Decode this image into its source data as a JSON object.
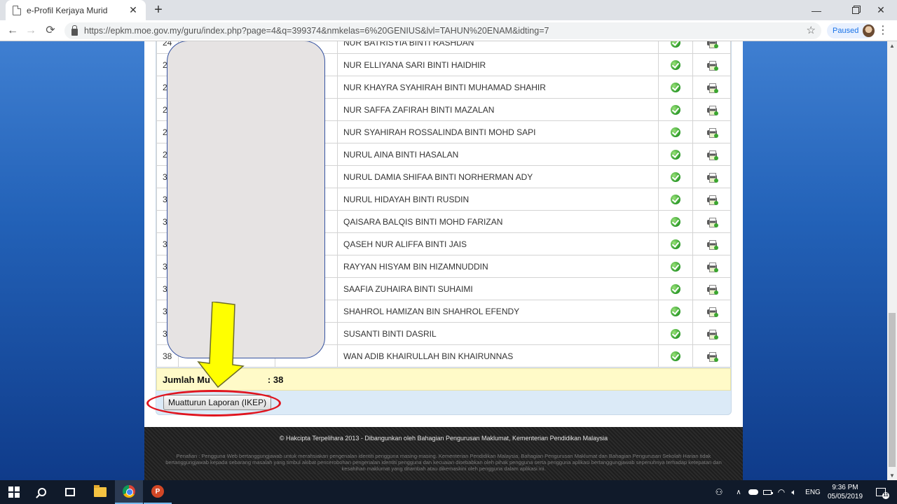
{
  "browser": {
    "tab_title": "e-Profil Kerjaya Murid",
    "tab_close": "✕",
    "new_tab": "+",
    "url": "https://epkm.moe.gov.my/guru/index.php?page=4&q=399374&nmkelas=6%20GENIUS&lvl=TAHUN%20ENAM&idting=7",
    "profile_status": "Paused",
    "window_min": "—",
    "window_close": "✕"
  },
  "students": [
    {
      "no": "24",
      "nama": "NUR BATRISYIA BINTI RASHDAN"
    },
    {
      "no": "2",
      "nama": "NUR ELLIYANA SARI BINTI HAIDHIR"
    },
    {
      "no": "2",
      "nama": "NUR KHAYRA SYAHIRAH BINTI MUHAMAD SHAHIR"
    },
    {
      "no": "2",
      "nama": "NUR SAFFA ZAFIRAH BINTI MAZALAN"
    },
    {
      "no": "2",
      "nama": "NUR SYAHIRAH ROSSALINDA BINTI MOHD SAPI"
    },
    {
      "no": "2",
      "nama": "NURUL AINA BINTI HASALAN"
    },
    {
      "no": "3",
      "nama": "NURUL DAMIA SHIFAA BINTI NORHERMAN ADY"
    },
    {
      "no": "3",
      "nama": "NURUL HIDAYAH BINTI RUSDIN"
    },
    {
      "no": "3",
      "nama": "QAISARA BALQIS BINTI MOHD FARIZAN"
    },
    {
      "no": "3",
      "nama": "QASEH NUR ALIFFA BINTI JAIS"
    },
    {
      "no": "3",
      "nama": "RAYYAN HISYAM BIN HIZAMNUDDIN"
    },
    {
      "no": "3",
      "nama": "SAAFIA ZUHAIRA BINTI SUHAIMI"
    },
    {
      "no": "3",
      "nama": "SHAHROL HAMIZAN BIN SHAHROL EFENDY"
    },
    {
      "no": "3",
      "nama": "SUSANTI BINTI DASRIL"
    },
    {
      "no": "38",
      "nama": "WAN ADIB KHAIRULLAH BIN KHAIRUNNAS"
    }
  ],
  "summary": {
    "label_start": "Jumlah Mu",
    "label_end": " : 38"
  },
  "download_button": "Muatturun Laporan (IKEP)",
  "footer": {
    "copyright": "© Hakcipta Terpelihara 2013 - Dibangunkan oleh Bahagian Pengurusan Maklumat, Kementerian Pendidikan Malaysia",
    "disclaimer": "Penafian : Pengguna Web bertanggungjawab untuk merahsiakan pengenalan identiti pengguna masing-masing. Kementerian Pendidikan Malaysia, Bahagian Pengurusan Maklumat dan Bahagian Pengurusan Sekolah Harian tidak bertanggungjawab kepada sebarang masalah yang timbul akibat pencerobohan pengenalan identiti pengguna dan kecuaian disebabkan oleh pihak pengguna serta pengguna aplikasi bertanggungjawab sepenuhnya terhadap ketepatan dan kesahihan maklumat yang ditambah atau dikemaskini oleh pengguna dalam aplikasi ini."
  },
  "taskbar": {
    "language": "ENG",
    "time": "9:36 PM",
    "date": "05/05/2019",
    "notification_count": "11",
    "ppt_letter": "P"
  },
  "colors": {
    "annotation_arrow": "#ffff00",
    "annotation_circle": "#e0141e",
    "summary_bg": "#fffac8",
    "status_green": "#2e9b2a"
  }
}
